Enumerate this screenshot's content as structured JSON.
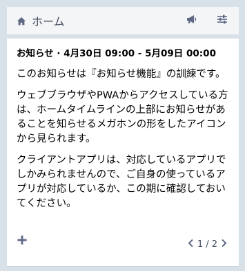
{
  "header": {
    "title": "ホーム",
    "icons": {
      "home": "home-icon",
      "announcement": "bullhorn-icon",
      "settings": "sliders-icon"
    }
  },
  "announcement": {
    "heading": "お知らせ · 4月30日 09:00 - 5月09日 00:00",
    "paragraphs": [
      "このお知らせは『お知らせ機能』の訓練です。",
      "ウェブブラウザやPWAからアクセスしている方は、ホームタイムラインの上部にお知らせがあることを知らせるメガホンの形をしたアイコンから見られます。",
      "クライアントアプリは、対応しているアプリでしかみられませんので、ご自身の使っているアプリが対応しているか、この期に確認しておいてください。"
    ]
  },
  "footer": {
    "add_icon": "plus-icon",
    "pager": "1 / 2",
    "prev_icon": "chevron-left-icon",
    "next_icon": "chevron-right-icon"
  },
  "colors": {
    "background": "#d9e1e8",
    "header_bg": "#f3f5f7",
    "panel_bg": "#ffffff",
    "icon": "#606984"
  }
}
